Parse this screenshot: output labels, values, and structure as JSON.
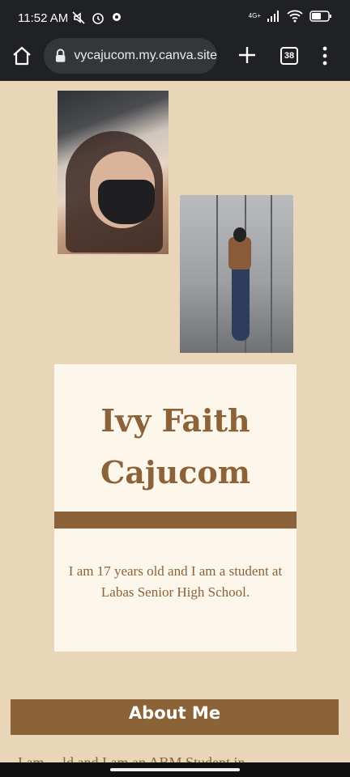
{
  "status_bar": {
    "time": "11:52 AM",
    "network": "4G+",
    "icons": [
      "mute-icon",
      "alarm-icon",
      "settings-icon",
      "signal-icon",
      "wifi-icon",
      "battery-icon"
    ]
  },
  "browser": {
    "url": "vycajucom.my.canva.site",
    "tab_count": "38",
    "icons": [
      "home-icon",
      "lock-icon",
      "plus-icon",
      "tabs-icon",
      "menu-icon"
    ]
  },
  "profile": {
    "name": "Ivy Faith Cajucom",
    "bio": "I am 17 years old and I am a student at Labas Senior High School."
  },
  "about": {
    "heading": "About Me",
    "partial_text": "I  am  ...  ld and I am an ABM Student in"
  },
  "colors": {
    "background": "#e9d5b8",
    "card": "#fdf6ea",
    "accent": "#8c6239"
  }
}
